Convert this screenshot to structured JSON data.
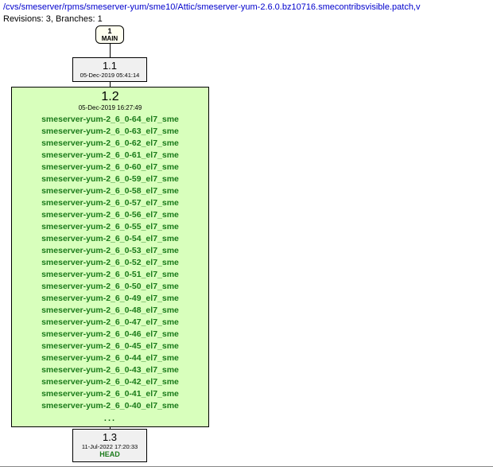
{
  "header": {
    "path": "/cvs/smeserver/rpms/smeserver-yum/sme10/Attic/smeserver-yum-2.6.0.bz10716.smecontribsvisible.patch,v",
    "revisions_line": "Revisions: 3, Branches: 1"
  },
  "nodes": {
    "main": {
      "num": "1",
      "label": "MAIN"
    },
    "r11": {
      "version": "1.1",
      "date": "05-Dec-2019 05:41:14"
    },
    "r12": {
      "version": "1.2",
      "date": "05-Dec-2019 16:27:49",
      "tags": [
        "smeserver-yum-2_6_0-64_el7_sme",
        "smeserver-yum-2_6_0-63_el7_sme",
        "smeserver-yum-2_6_0-62_el7_sme",
        "smeserver-yum-2_6_0-61_el7_sme",
        "smeserver-yum-2_6_0-60_el7_sme",
        "smeserver-yum-2_6_0-59_el7_sme",
        "smeserver-yum-2_6_0-58_el7_sme",
        "smeserver-yum-2_6_0-57_el7_sme",
        "smeserver-yum-2_6_0-56_el7_sme",
        "smeserver-yum-2_6_0-55_el7_sme",
        "smeserver-yum-2_6_0-54_el7_sme",
        "smeserver-yum-2_6_0-53_el7_sme",
        "smeserver-yum-2_6_0-52_el7_sme",
        "smeserver-yum-2_6_0-51_el7_sme",
        "smeserver-yum-2_6_0-50_el7_sme",
        "smeserver-yum-2_6_0-49_el7_sme",
        "smeserver-yum-2_6_0-48_el7_sme",
        "smeserver-yum-2_6_0-47_el7_sme",
        "smeserver-yum-2_6_0-46_el7_sme",
        "smeserver-yum-2_6_0-45_el7_sme",
        "smeserver-yum-2_6_0-44_el7_sme",
        "smeserver-yum-2_6_0-43_el7_sme",
        "smeserver-yum-2_6_0-42_el7_sme",
        "smeserver-yum-2_6_0-41_el7_sme",
        "smeserver-yum-2_6_0-40_el7_sme"
      ],
      "ellipsis": "..."
    },
    "r13": {
      "version": "1.3",
      "date": "11-Jul-2022 17:20:33",
      "head": "HEAD"
    }
  }
}
